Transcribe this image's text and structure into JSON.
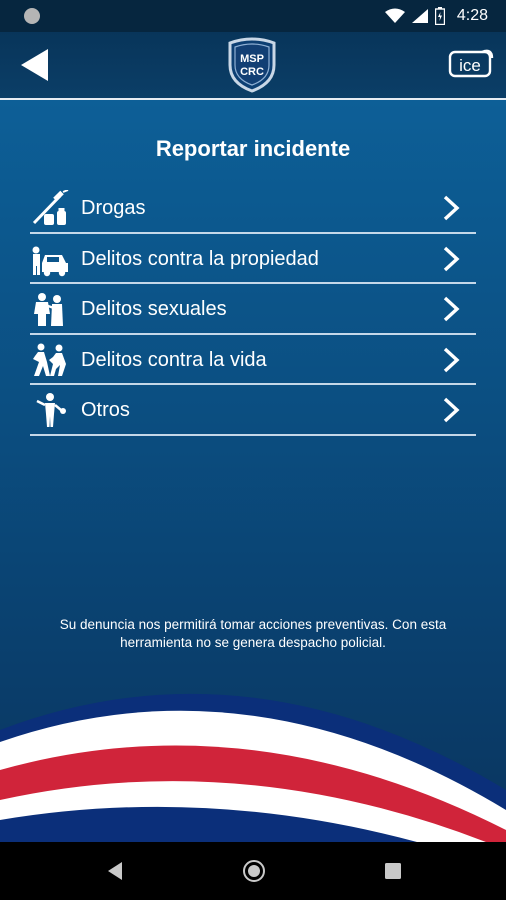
{
  "status_bar": {
    "time": "4:28",
    "icons": [
      "notification-dot-icon",
      "wifi-icon",
      "signal-icon",
      "battery-icon"
    ]
  },
  "app_bar": {
    "back_icon": "back-arrow-icon",
    "logo_text_line1": "MSP",
    "logo_text_line2": "CRC",
    "partner_logo_text": "ice"
  },
  "main": {
    "title": "Reportar incidente",
    "items": [
      {
        "label": "Drogas",
        "icon": "drugs-icon"
      },
      {
        "label": "Delitos contra la propiedad",
        "icon": "property-crime-icon"
      },
      {
        "label": "Delitos sexuales",
        "icon": "sexual-crime-icon"
      },
      {
        "label": "Delitos contra la vida",
        "icon": "violent-crime-icon"
      },
      {
        "label": "Otros",
        "icon": "other-icon"
      }
    ],
    "disclaimer_line1": "Su denuncia nos permitirá tomar acciones preventivas. Con esta",
    "disclaimer_line2": "herramienta no se genera despacho policial."
  },
  "colors": {
    "header": "#08355a",
    "background_top": "#0d5f97",
    "background_bottom": "#0a355f",
    "flag_blue": "#0b2f7a",
    "flag_red": "#d0243a",
    "flag_white": "#ffffff"
  },
  "nav_bar": {
    "icons": [
      "nav-back-icon",
      "nav-home-icon",
      "nav-recents-icon"
    ]
  }
}
